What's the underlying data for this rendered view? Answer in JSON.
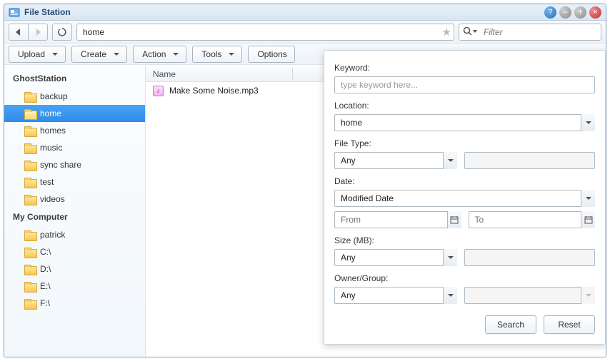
{
  "window": {
    "title": "File Station"
  },
  "nav": {
    "address": "home",
    "filter_placeholder": "Filter"
  },
  "toolbar": {
    "upload": "Upload",
    "create": "Create",
    "action": "Action",
    "tools": "Tools",
    "options": "Options"
  },
  "sidebar": {
    "roots": [
      {
        "label": "GhostStation",
        "items": [
          {
            "label": "backup"
          },
          {
            "label": "home",
            "selected": true
          },
          {
            "label": "homes"
          },
          {
            "label": "music"
          },
          {
            "label": "sync share"
          },
          {
            "label": "test"
          },
          {
            "label": "videos"
          }
        ]
      },
      {
        "label": "My Computer",
        "items": [
          {
            "label": "patrick"
          },
          {
            "label": "C:\\"
          },
          {
            "label": "D:\\"
          },
          {
            "label": "E:\\"
          },
          {
            "label": "F:\\"
          }
        ]
      }
    ]
  },
  "columns": {
    "name": "Name"
  },
  "files": [
    {
      "name": "Make Some Noise.mp3",
      "type": "audio"
    }
  ],
  "search": {
    "keyword_label": "Keyword:",
    "keyword_placeholder": "type keyword here...",
    "location_label": "Location:",
    "location_value": "home",
    "filetype_label": "File Type:",
    "filetype_value": "Any",
    "date_label": "Date:",
    "date_type_value": "Modified Date",
    "date_from_placeholder": "From",
    "date_to_placeholder": "To",
    "size_label": "Size (MB):",
    "size_value": "Any",
    "owner_label": "Owner/Group:",
    "owner_value": "Any",
    "search_btn": "Search",
    "reset_btn": "Reset"
  }
}
